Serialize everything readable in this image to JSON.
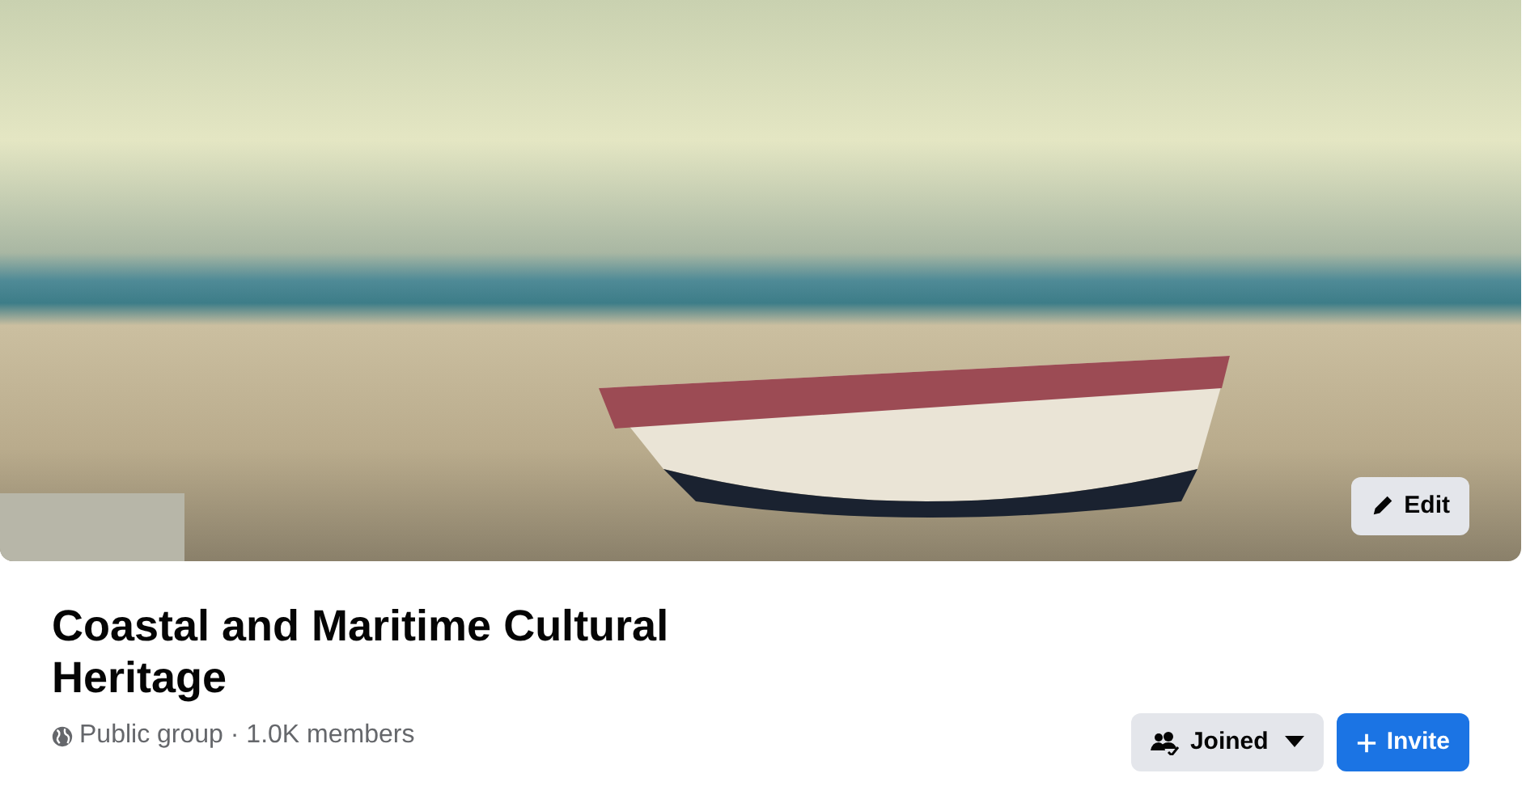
{
  "cover": {
    "edit_button": "Edit"
  },
  "group": {
    "title": "Coastal and Maritime Cultural Heritage",
    "meta": "Public group · 1.0K members"
  },
  "actions": [
    {
      "kind": "joined",
      "label": "Joined"
    },
    {
      "kind": "invite",
      "label": "Invite"
    }
  ]
}
